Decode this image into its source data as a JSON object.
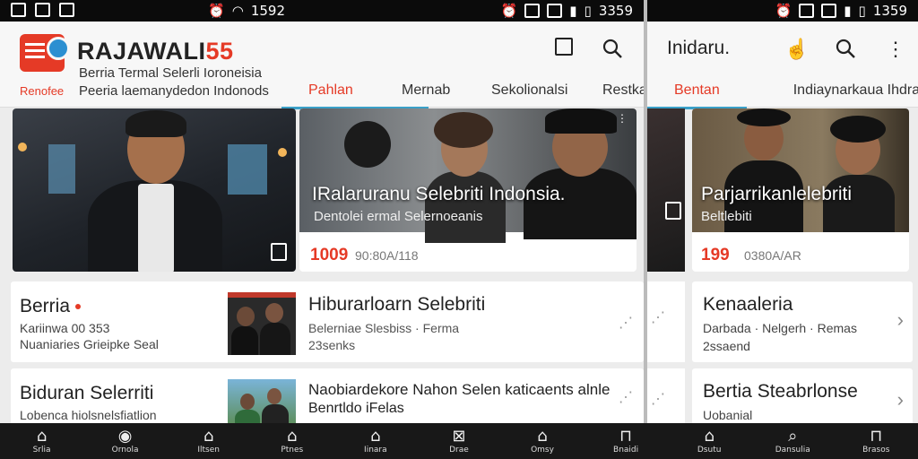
{
  "status_left": {
    "time": "1592"
  },
  "status_right": {
    "time": "1359"
  },
  "status_mid": {
    "time": "3359"
  },
  "app": {
    "brand_main": "RAJAWALI",
    "brand_num": "55",
    "subtitle1": "Berria Termal Selerli Ioroneisia",
    "subtitle2": "Peeria laemanydedon Indonods",
    "small_label": "Renofee"
  },
  "tabs": [
    {
      "label": "Pahlan"
    },
    {
      "label": "Mernab"
    },
    {
      "label": "Sekolionalsi"
    },
    {
      "label": "Restka"
    }
  ],
  "hero": {
    "title": "IRalaruranu Selebriti Indonsia.",
    "subtitle": "Dentolei ermal Selernoeanis",
    "count": "1009",
    "meta": "90:80A/118"
  },
  "cards": [
    {
      "left_title": "Berria",
      "left_sub1": "Kariinwa 00 353",
      "left_sub2": "Nuaniaries Grieipke Seal",
      "right_title": "Hiburarloarn Selebriti",
      "right_sub1": "Belerniae Slesbiss · Ferma",
      "right_sub2": "23senks"
    },
    {
      "left_title": "Biduran Selerriti",
      "left_sub1": "Lobenca hiolsnelsfiatlion",
      "left_sub2": "",
      "right_title": "Naobiardekore Nahon Selen katicaents alnle",
      "right_sub1": "Benrtldo iFelas",
      "right_sub2": ""
    }
  ],
  "panel2": {
    "header_title": "Inidaru.",
    "tabs": [
      {
        "label": "Bentan"
      },
      {
        "label": "Indiaynarkaua Ihdras"
      }
    ],
    "hero_title": "Parjarrikanlelebriti",
    "hero_sub": "Beltlebiti",
    "hero_count": "199",
    "hero_meta": "0380A/AR",
    "cards": [
      {
        "title": "Kenaaleria",
        "sub1": "Darbada · Nelgerh · Remas",
        "sub2": "2ssaend"
      },
      {
        "title": "Bertia Steabrlonse",
        "sub1": "Uobanial",
        "sub2": ""
      }
    ]
  },
  "nav": [
    {
      "label": "Srlia",
      "icon": "home-filled-icon"
    },
    {
      "label": "Ornola",
      "icon": "circle-icon"
    },
    {
      "label": "Iltsen",
      "icon": "home-icon"
    },
    {
      "label": "Ptnes",
      "icon": "home-icon"
    },
    {
      "label": "Iinara",
      "icon": "home-icon"
    },
    {
      "label": "Drae",
      "icon": "x-icon"
    },
    {
      "label": "Omsy",
      "icon": "home-icon"
    },
    {
      "label": "Bnaidi",
      "icon": "bag-icon"
    },
    {
      "label": "Dsutu",
      "icon": "home-icon"
    },
    {
      "label": "Dansulia",
      "icon": "search-icon"
    },
    {
      "label": "Brasos",
      "icon": "bag-icon"
    }
  ],
  "colors": {
    "accent": "#e53a26",
    "tab_underline": "#3aa0c8"
  }
}
